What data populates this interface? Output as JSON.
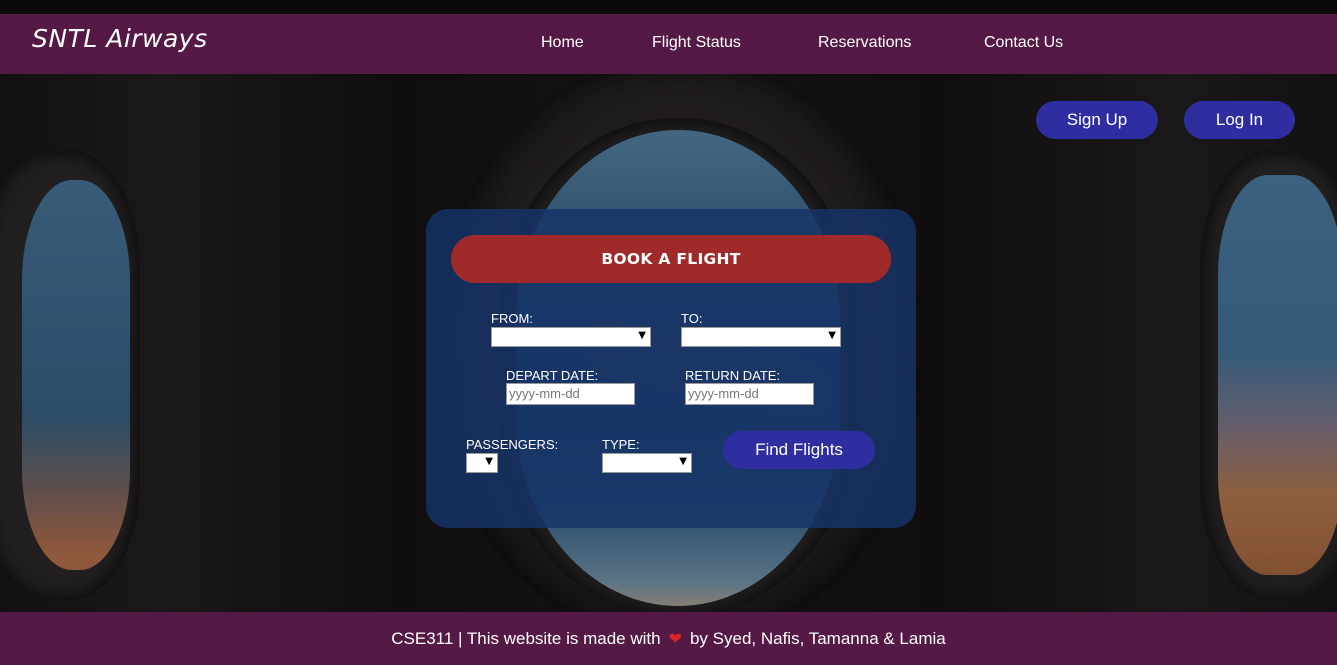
{
  "brand": {
    "name": "SNTL Airways"
  },
  "nav": {
    "items": [
      {
        "label": "Home"
      },
      {
        "label": "Flight Status"
      },
      {
        "label": "Reservations"
      },
      {
        "label": "Contact Us"
      }
    ]
  },
  "auth": {
    "signup_label": "Sign Up",
    "login_label": "Log In"
  },
  "booking": {
    "title": "BOOK A FLIGHT",
    "from_label": "FROM:",
    "from_value": "",
    "to_label": "TO:",
    "to_value": "",
    "depart_label": "DEPART DATE:",
    "depart_placeholder": "yyyy-mm-dd",
    "return_label": "RETURN DATE:",
    "return_placeholder": "yyyy-mm-dd",
    "passengers_label": "PASSENGERS:",
    "passengers_value": "",
    "type_label": "TYPE:",
    "type_value": "",
    "find_label": "Find Flights"
  },
  "footer": {
    "prefix": "CSE311 | This website is made with",
    "heart_icon": "heart-icon",
    "suffix": "by Syed, Nafis, Tamanna & Lamia"
  },
  "colors": {
    "nav_bg": "#541944",
    "button_bg": "#2e2ea0",
    "header_bg": "#a02a2a",
    "panel_bg": "#163469"
  }
}
